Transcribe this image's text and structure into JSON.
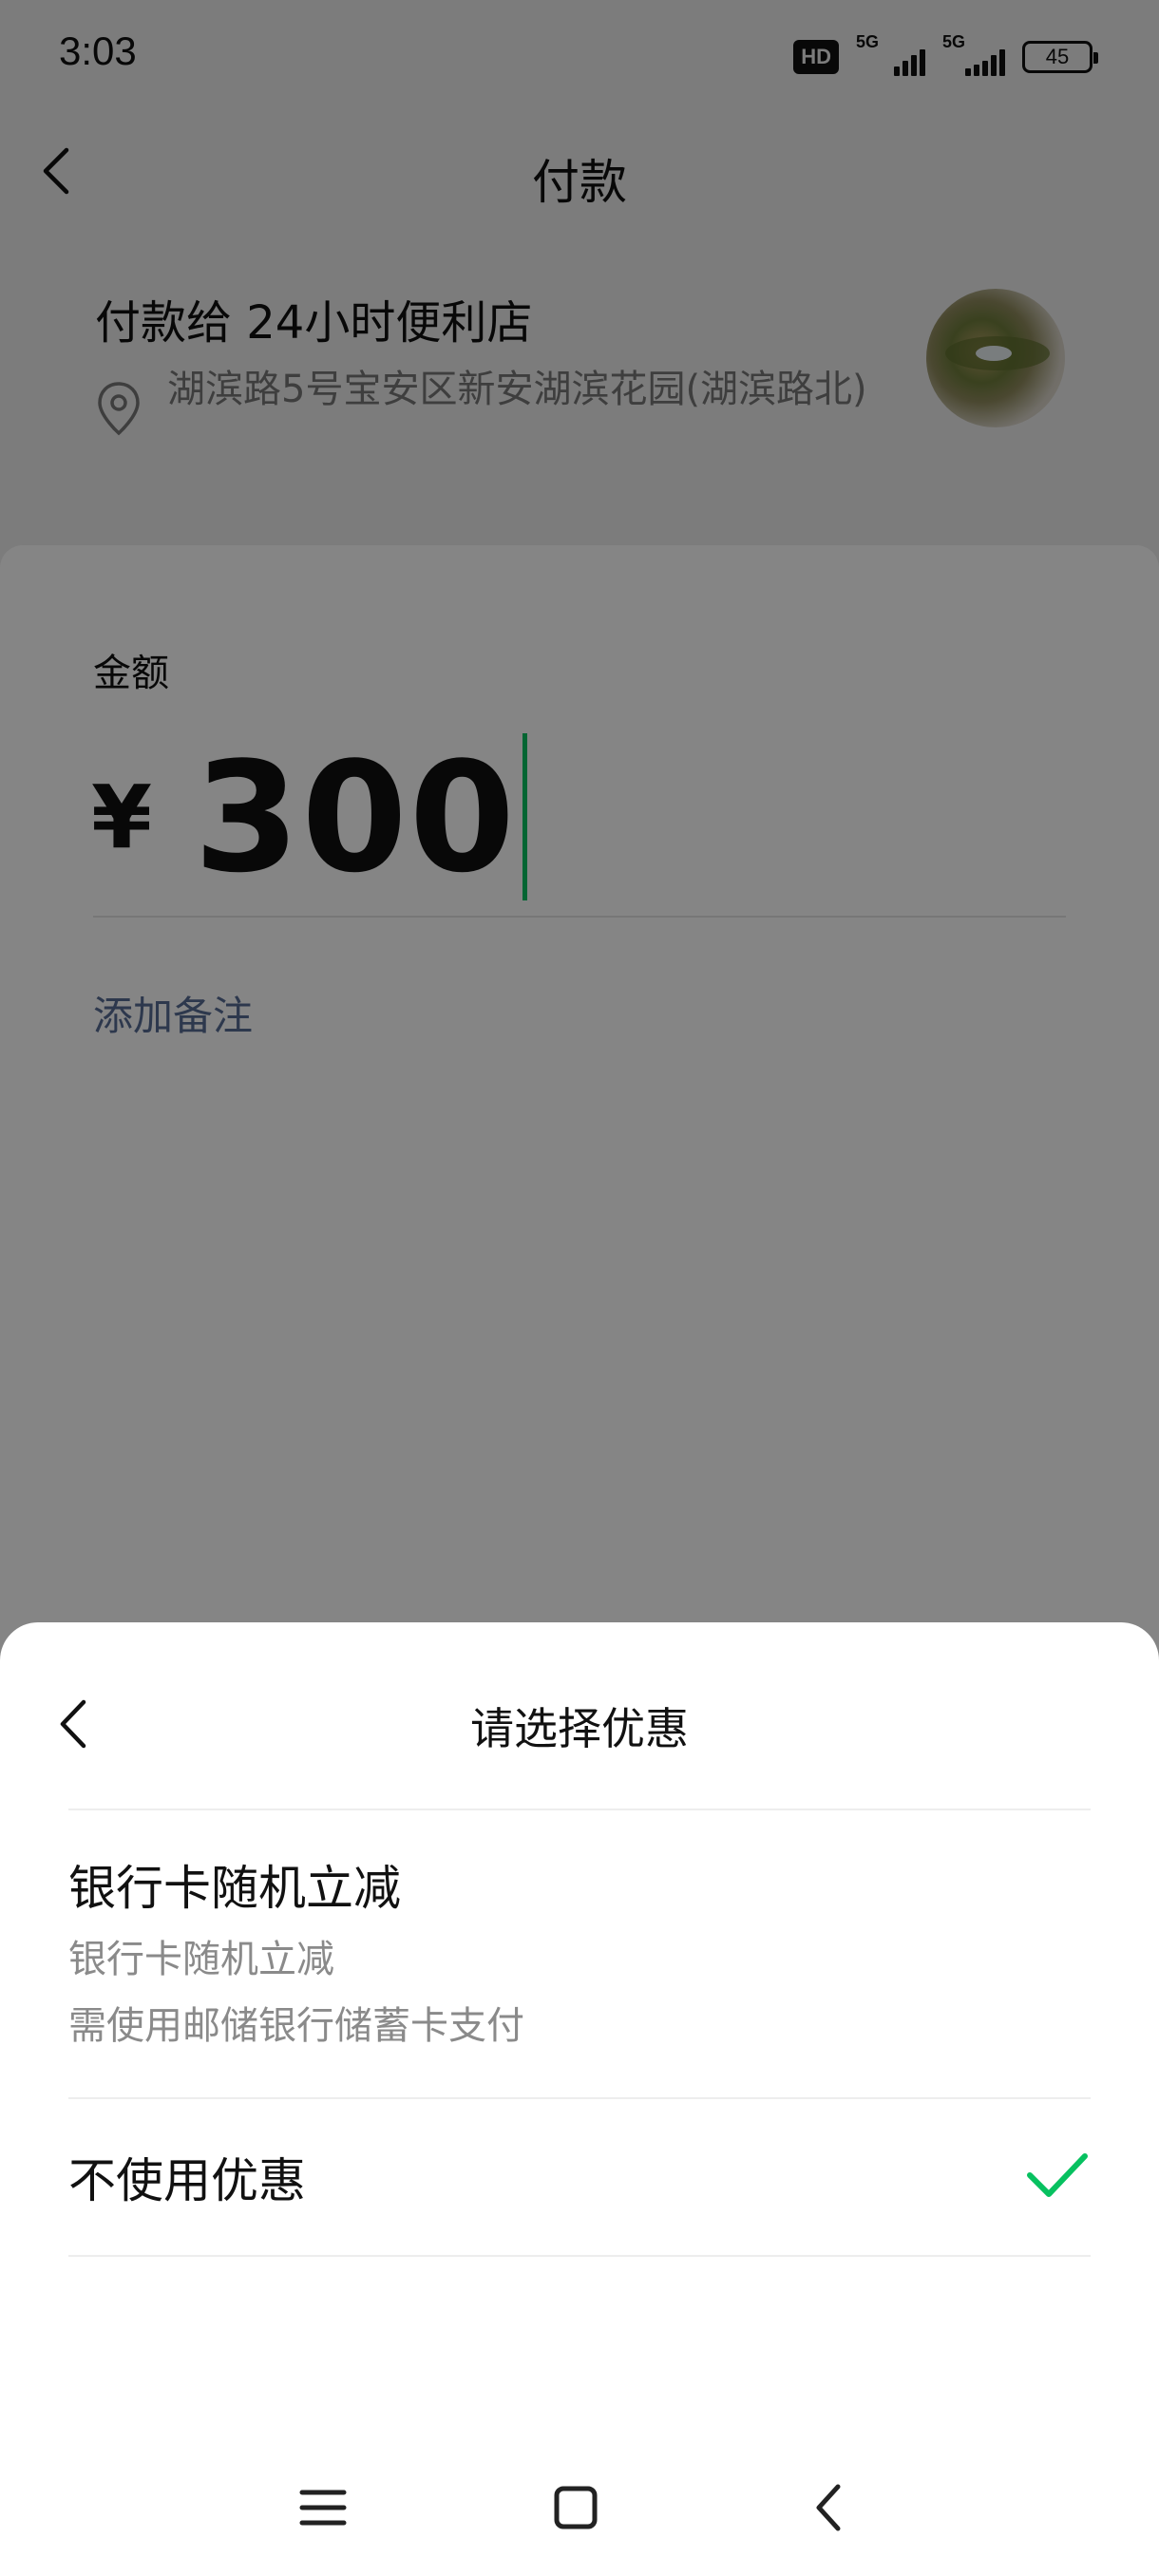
{
  "status_bar": {
    "time": "3:03",
    "hd_badge": "HD",
    "signal_1": "5G",
    "signal_2": "5G",
    "battery": "45"
  },
  "header": {
    "title": "付款",
    "back_icon": "chevron-left-icon"
  },
  "merchant": {
    "title": "付款给 24小时便利店",
    "address": "湖滨路5号宝安区新安湖滨花园(湖滨路北)"
  },
  "amount": {
    "label": "金额",
    "currency": "¥",
    "value": "300"
  },
  "remark": {
    "label": "添加备注"
  },
  "sheet": {
    "title": "请选择优惠",
    "options": [
      {
        "title": "银行卡随机立减",
        "line1": "银行卡随机立减",
        "line2": "需使用邮储银行储蓄卡支付",
        "selected": false
      },
      {
        "title": "不使用优惠",
        "selected": true
      }
    ]
  },
  "colors": {
    "accent": "#07c160",
    "link": "#576b95",
    "overlay": "rgba(0,0,0,0.48)"
  }
}
